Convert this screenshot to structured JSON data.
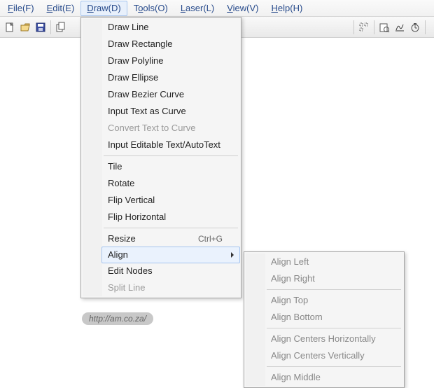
{
  "menubar": {
    "items": [
      {
        "pre": "",
        "u": "F",
        "post": "ile(F)"
      },
      {
        "pre": "",
        "u": "E",
        "post": "dit(E)"
      },
      {
        "pre": "",
        "u": "D",
        "post": "raw(D)"
      },
      {
        "pre": "T",
        "u": "o",
        "post": "ols(O)"
      },
      {
        "pre": "",
        "u": "L",
        "post": "aser(L)"
      },
      {
        "pre": "",
        "u": "V",
        "post": "iew(V)"
      },
      {
        "pre": "",
        "u": "H",
        "post": "elp(H)"
      }
    ],
    "activeIndex": 2
  },
  "dropdown": {
    "groups": [
      [
        {
          "label": "Draw Line"
        },
        {
          "label": "Draw Rectangle"
        },
        {
          "label": "Draw Polyline"
        },
        {
          "label": "Draw Ellipse"
        },
        {
          "label": "Draw Bezier Curve"
        },
        {
          "label": "Input Text as Curve"
        },
        {
          "label": "Convert Text to Curve",
          "disabled": true
        },
        {
          "label": "Input Editable Text/AutoText"
        }
      ],
      [
        {
          "label": "Tile"
        },
        {
          "label": "Rotate"
        },
        {
          "label": "Flip Vertical"
        },
        {
          "label": "Flip Horizontal"
        }
      ],
      [
        {
          "label": "Resize",
          "shortcut": "Ctrl+G"
        },
        {
          "label": "Align",
          "submenu": true,
          "hover": true
        },
        {
          "label": "Edit Nodes"
        },
        {
          "label": "Split Line",
          "disabled": true
        }
      ]
    ]
  },
  "submenu": {
    "groups": [
      [
        {
          "label": "Align Left"
        },
        {
          "label": "Align Right"
        }
      ],
      [
        {
          "label": "Align Top"
        },
        {
          "label": "Align Bottom"
        }
      ],
      [
        {
          "label": "Align Centers Horizontally"
        },
        {
          "label": "Align Centers Vertically"
        }
      ],
      [
        {
          "label": "Align Middle"
        }
      ]
    ]
  },
  "watermark": "http://am.co.za/"
}
